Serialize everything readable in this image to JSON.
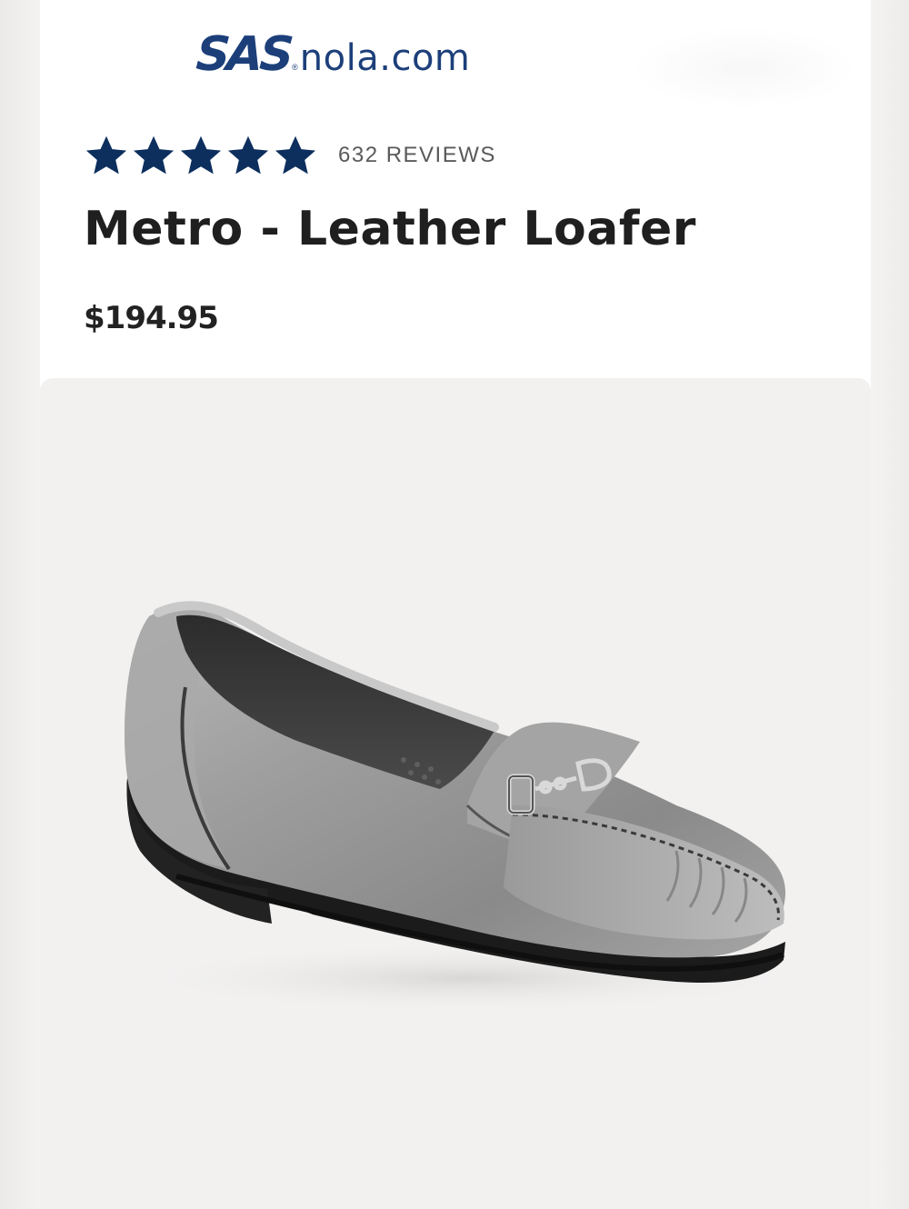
{
  "brand": {
    "logo_mark": "SAS",
    "logo_domain": "nola.com",
    "logo_registered": "®",
    "color": "#1c3f7a"
  },
  "product": {
    "rating": {
      "stars": 5,
      "star_color": "#0d2f5e",
      "review_count_label": "632 REVIEWS"
    },
    "title": "Metro - Leather Loafer",
    "price": "$194.95",
    "image": {
      "alt": "Pewter metallic leather loafer with bit buckle",
      "icon": "loafer-shoe-image"
    }
  }
}
